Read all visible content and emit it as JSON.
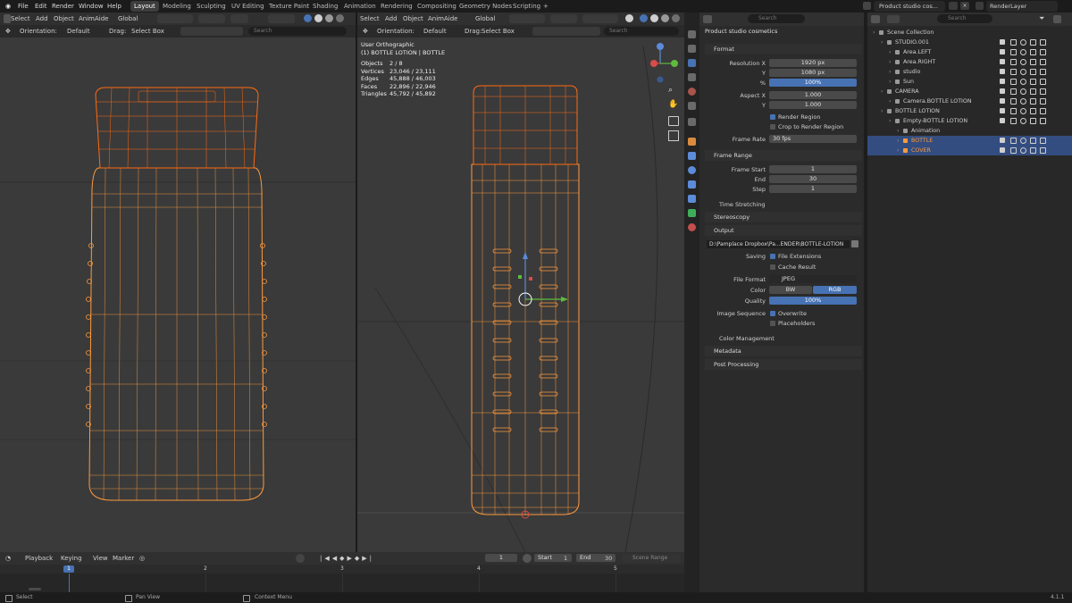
{
  "top_menu": [
    "File",
    "Edit",
    "Render",
    "Window",
    "Help"
  ],
  "workspaces": [
    "Layout",
    "Modeling",
    "Sculpting",
    "UV Editing",
    "Texture Paint",
    "Shading",
    "Animation",
    "Rendering",
    "Compositing",
    "Geometry Nodes",
    "Scripting"
  ],
  "active_workspace": "Layout",
  "scene_name": "Product studio cos...",
  "view_layer": "RenderLayer",
  "left_view": {
    "menus": [
      "Select",
      "Add",
      "Object",
      "AnimAide"
    ],
    "transform": "Global",
    "orientation_label": "Orientation:",
    "orientation_value": "Default",
    "drag_label": "Drag:",
    "drag_value": "Select Box",
    "search_placeholder": "Search"
  },
  "right_view": {
    "menus": [
      "Select",
      "Add",
      "Object",
      "AnimAide"
    ],
    "transform": "Global",
    "orientation_label": "Orientation:",
    "orientation_value": "Default",
    "drag_label": "Drag:",
    "drag_value": "Select Box",
    "search_placeholder": "Search",
    "view_name": "User Orthographic",
    "collection_info": "(1) BOTTLE LOTION | BOTTLE",
    "stats": [
      {
        "label": "Objects",
        "value": "2 / 8"
      },
      {
        "label": "Vertices",
        "value": "23,046 / 23,111"
      },
      {
        "label": "Edges",
        "value": "45,888 / 46,003"
      },
      {
        "label": "Faces",
        "value": "22,896 / 22,946"
      },
      {
        "label": "Triangles",
        "value": "45,792 / 45,892"
      }
    ]
  },
  "properties": {
    "search_placeholder": "Search",
    "scene_title": "Product studio cosmetics",
    "format_header": "Format",
    "resolution_x_label": "Resolution X",
    "resolution_x": "1920 px",
    "resolution_y_label": "Y",
    "resolution_y": "1080 px",
    "resolution_pct_label": "%",
    "resolution_pct": "100%",
    "aspect_x_label": "Aspect X",
    "aspect_x": "1.000",
    "aspect_y_label": "Y",
    "aspect_y": "1.000",
    "render_region": "Render Region",
    "crop_region": "Crop to Render Region",
    "frame_rate_label": "Frame Rate",
    "frame_rate": "30 fps",
    "frame_range_header": "Frame Range",
    "frame_start_label": "Frame Start",
    "frame_start": "1",
    "end_label": "End",
    "end": "30",
    "step_label": "Step",
    "step": "1",
    "time_stretching": "Time Stretching",
    "stereoscopy": "Stereoscopy",
    "output_header": "Output",
    "output_path": "D:\\Pamplace Dropbox\\Pa...ENDER\\BOTTLE-LOTION",
    "saving_label": "Saving",
    "file_extensions": "File Extensions",
    "cache_result": "Cache Result",
    "file_format_label": "File Format",
    "file_format": "JPEG",
    "color_label": "Color",
    "color_bw": "BW",
    "color_rgb": "RGB",
    "quality_label": "Quality",
    "quality": "100%",
    "image_sequence_label": "Image Sequence",
    "overwrite": "Overwrite",
    "placeholders": "Placeholders",
    "color_management": "Color Management",
    "metadata_header": "Metadata",
    "post_processing_header": "Post Processing"
  },
  "outliner": {
    "search_placeholder": "Search",
    "rows": [
      {
        "label": "Scene Collection",
        "indent": 0,
        "color": "#cfcfcf",
        "selected": false,
        "vis": false
      },
      {
        "label": "STUDIO.001",
        "indent": 1,
        "color": "#cfcfcf",
        "selected": false,
        "vis": true
      },
      {
        "label": "Area.LEFT",
        "indent": 2,
        "color": "#cfcfcf",
        "selected": false,
        "vis": true
      },
      {
        "label": "Area.RIGHT",
        "indent": 2,
        "color": "#cfcfcf",
        "selected": false,
        "vis": true
      },
      {
        "label": "studio",
        "indent": 2,
        "color": "#cfcfcf",
        "selected": false,
        "vis": true
      },
      {
        "label": "Sun",
        "indent": 2,
        "color": "#cfcfcf",
        "selected": false,
        "vis": true
      },
      {
        "label": "CAMERA",
        "indent": 1,
        "color": "#cfcfcf",
        "selected": false,
        "vis": true
      },
      {
        "label": "Camera.BOTTLE LOTION",
        "indent": 2,
        "color": "#cfcfcf",
        "selected": false,
        "vis": true
      },
      {
        "label": "BOTTLE LOTION",
        "indent": 1,
        "color": "#cfcfcf",
        "selected": false,
        "vis": true
      },
      {
        "label": "Empty-BOTTLE LOTION",
        "indent": 2,
        "color": "#cfcfcf",
        "selected": false,
        "vis": true
      },
      {
        "label": "Animation",
        "indent": 3,
        "color": "#cfcfcf",
        "selected": false,
        "vis": false
      },
      {
        "label": "BOTTLE",
        "indent": 3,
        "color": "#ff9a3d",
        "selected": true,
        "vis": true
      },
      {
        "label": "COVER",
        "indent": 3,
        "color": "#ff9a3d",
        "selected": true,
        "vis": true
      }
    ]
  },
  "timeline": {
    "menus": [
      "Playback",
      "Keying",
      "View",
      "Marker"
    ],
    "current_frame": "1",
    "start_label": "Start",
    "start": "1",
    "end_label": "End",
    "end": "30",
    "scene_range": "Scene Range",
    "ticks": [
      "1",
      "2",
      "3",
      "4",
      "5"
    ]
  },
  "status": {
    "select": "Select",
    "pan_view": "Pan View",
    "context_menu": "Context Menu",
    "version": "4.1.1"
  },
  "colors": {
    "accent": "#4772b3",
    "wire_orange": "#ff9a3d",
    "wire_orange_dark": "#ff6a10",
    "viewport_bg": "#3a3a3a"
  }
}
